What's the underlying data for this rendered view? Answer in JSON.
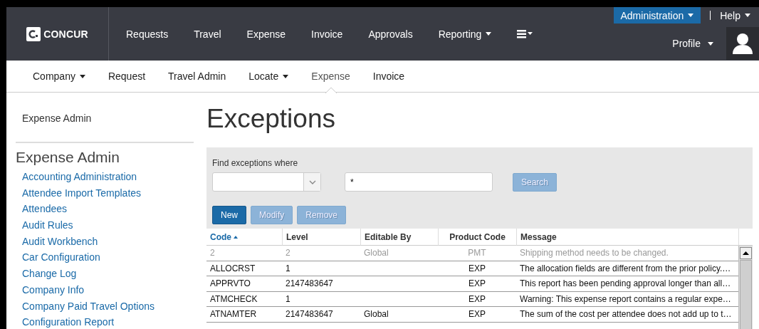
{
  "header": {
    "logo": "CONCUR",
    "nav": [
      {
        "label": "Requests",
        "dropdown": false
      },
      {
        "label": "Travel",
        "dropdown": false
      },
      {
        "label": "Expense",
        "dropdown": false
      },
      {
        "label": "Invoice",
        "dropdown": false
      },
      {
        "label": "Approvals",
        "dropdown": false
      },
      {
        "label": "Reporting",
        "dropdown": true
      }
    ],
    "admin": "Administration",
    "help": "Help",
    "profile": "Profile"
  },
  "subnav": [
    {
      "label": "Company",
      "dropdown": true,
      "selected": false
    },
    {
      "label": "Request",
      "dropdown": false,
      "selected": false
    },
    {
      "label": "Travel Admin",
      "dropdown": false,
      "selected": false
    },
    {
      "label": "Locate",
      "dropdown": true,
      "selected": false
    },
    {
      "label": "Expense",
      "dropdown": false,
      "selected": true
    },
    {
      "label": "Invoice",
      "dropdown": false,
      "selected": false
    }
  ],
  "sidebar": {
    "top_link": "Expense Admin",
    "heading": "Expense Admin",
    "items": [
      "Accounting Administration",
      "Attendee Import Templates",
      "Attendees",
      "Audit Rules",
      "Audit Workbench",
      "Car Configuration",
      "Change Log",
      "Company Info",
      "Company Paid Travel Options",
      "Configuration Report"
    ]
  },
  "page_title": "Exceptions",
  "search": {
    "label": "Find exceptions where",
    "value": "*",
    "button": "Search",
    "button_disabled": true
  },
  "actions": [
    {
      "label": "New",
      "disabled": false
    },
    {
      "label": "Modify",
      "disabled": true
    },
    {
      "label": "Remove",
      "disabled": true
    }
  ],
  "table": {
    "columns": [
      {
        "label": "Code",
        "sorted": true
      },
      {
        "label": "Level",
        "sorted": false
      },
      {
        "label": "Editable By",
        "sorted": false
      },
      {
        "label": "Product Code",
        "sorted": false
      },
      {
        "label": "Message",
        "sorted": false
      }
    ],
    "rows": [
      {
        "cells": [
          "2",
          "2",
          "Global",
          "PMT",
          "Shipping method needs to be changed."
        ],
        "inactive": true
      },
      {
        "cells": [
          "ALLOCRST",
          "1",
          "",
          "EXP",
          "The allocation fields are different from the prior policy.…"
        ],
        "inactive": false
      },
      {
        "cells": [
          "APPRVTO",
          "2147483647",
          "",
          "EXP",
          "This report has been pending approval longer than all…"
        ],
        "inactive": false
      },
      {
        "cells": [
          "ATMCHECK",
          "1",
          "",
          "EXP",
          "Warning: This expense report contains a regular expe…"
        ],
        "inactive": false
      },
      {
        "cells": [
          "ATNAMTER",
          "2147483647",
          "Global",
          "EXP",
          "The sum of the cost per attendee does not add up to t…"
        ],
        "inactive": false
      }
    ]
  }
}
